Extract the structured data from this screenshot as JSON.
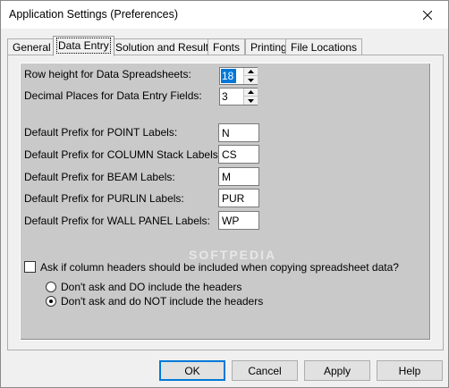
{
  "window": {
    "title": "Application Settings (Preferences)"
  },
  "tabs": [
    {
      "label": "General",
      "active": false
    },
    {
      "label": "Data Entry",
      "active": true
    },
    {
      "label": "Solution and Results",
      "active": false
    },
    {
      "label": "Fonts",
      "active": false
    },
    {
      "label": "Printing",
      "active": false
    },
    {
      "label": "File Locations",
      "active": false
    }
  ],
  "data_entry": {
    "row_height": {
      "label": "Row height for Data Spreadsheets:",
      "value": "18"
    },
    "decimal_places": {
      "label": "Decimal Places for Data Entry Fields:",
      "value": "3"
    },
    "prefixes": [
      {
        "label": "Default Prefix for POINT Labels:",
        "value": "N"
      },
      {
        "label": "Default Prefix for COLUMN Stack Labels:",
        "value": "CS"
      },
      {
        "label": "Default Prefix for BEAM Labels:",
        "value": "M"
      },
      {
        "label": "Default Prefix for PURLIN Labels:",
        "value": "PUR"
      },
      {
        "label": "Default Prefix for WALL PANEL Labels:",
        "value": "WP"
      }
    ],
    "ask_headers": {
      "label": "Ask if column headers should be included when copying spreadsheet data?",
      "checked": false
    },
    "radio_options": [
      {
        "label": "Don't ask and DO include the headers",
        "checked": false
      },
      {
        "label": "Don't ask and do NOT include the headers",
        "checked": true
      }
    ]
  },
  "watermark": "SOFTPEDIA",
  "buttons": {
    "ok": "OK",
    "cancel": "Cancel",
    "apply": "Apply",
    "help": "Help"
  },
  "icons": {
    "close": "close-icon",
    "spin_up": "spin-up-arrow-icon",
    "spin_down": "spin-down-arrow-icon"
  }
}
